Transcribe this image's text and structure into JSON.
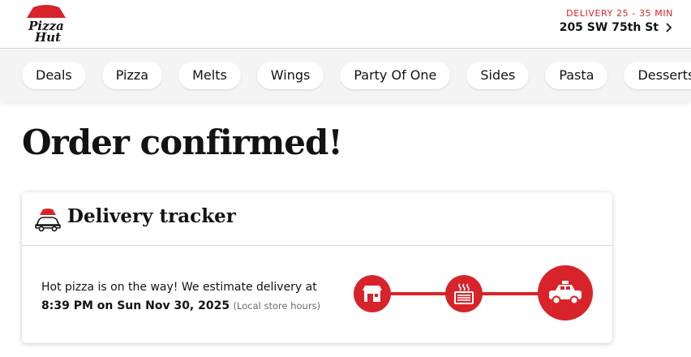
{
  "header": {
    "logo_alt": "Pizza Hut",
    "delivery_label": "DELIVERY 25 - 35 MIN",
    "address": "205 SW 75th St"
  },
  "categories": [
    {
      "label": "Deals"
    },
    {
      "label": "Pizza"
    },
    {
      "label": "Melts"
    },
    {
      "label": "Wings"
    },
    {
      "label": "Party Of One"
    },
    {
      "label": "Sides"
    },
    {
      "label": "Pasta"
    },
    {
      "label": "Desserts"
    }
  ],
  "main": {
    "title": "Order confirmed!"
  },
  "tracker": {
    "title": "Delivery tracker",
    "message_line1": "Hot pizza is on the way! We estimate delivery at",
    "eta": "8:39 PM on Sun Nov 30, 2025",
    "eta_note": "(Local store hours)",
    "steps": [
      {
        "icon": "store-icon",
        "state": "done"
      },
      {
        "icon": "oven-icon",
        "state": "done"
      },
      {
        "icon": "car-icon",
        "state": "current"
      }
    ]
  },
  "colors": {
    "brand_red": "#d8232a",
    "text": "#131313",
    "nav_bg": "#f4f4f4"
  }
}
